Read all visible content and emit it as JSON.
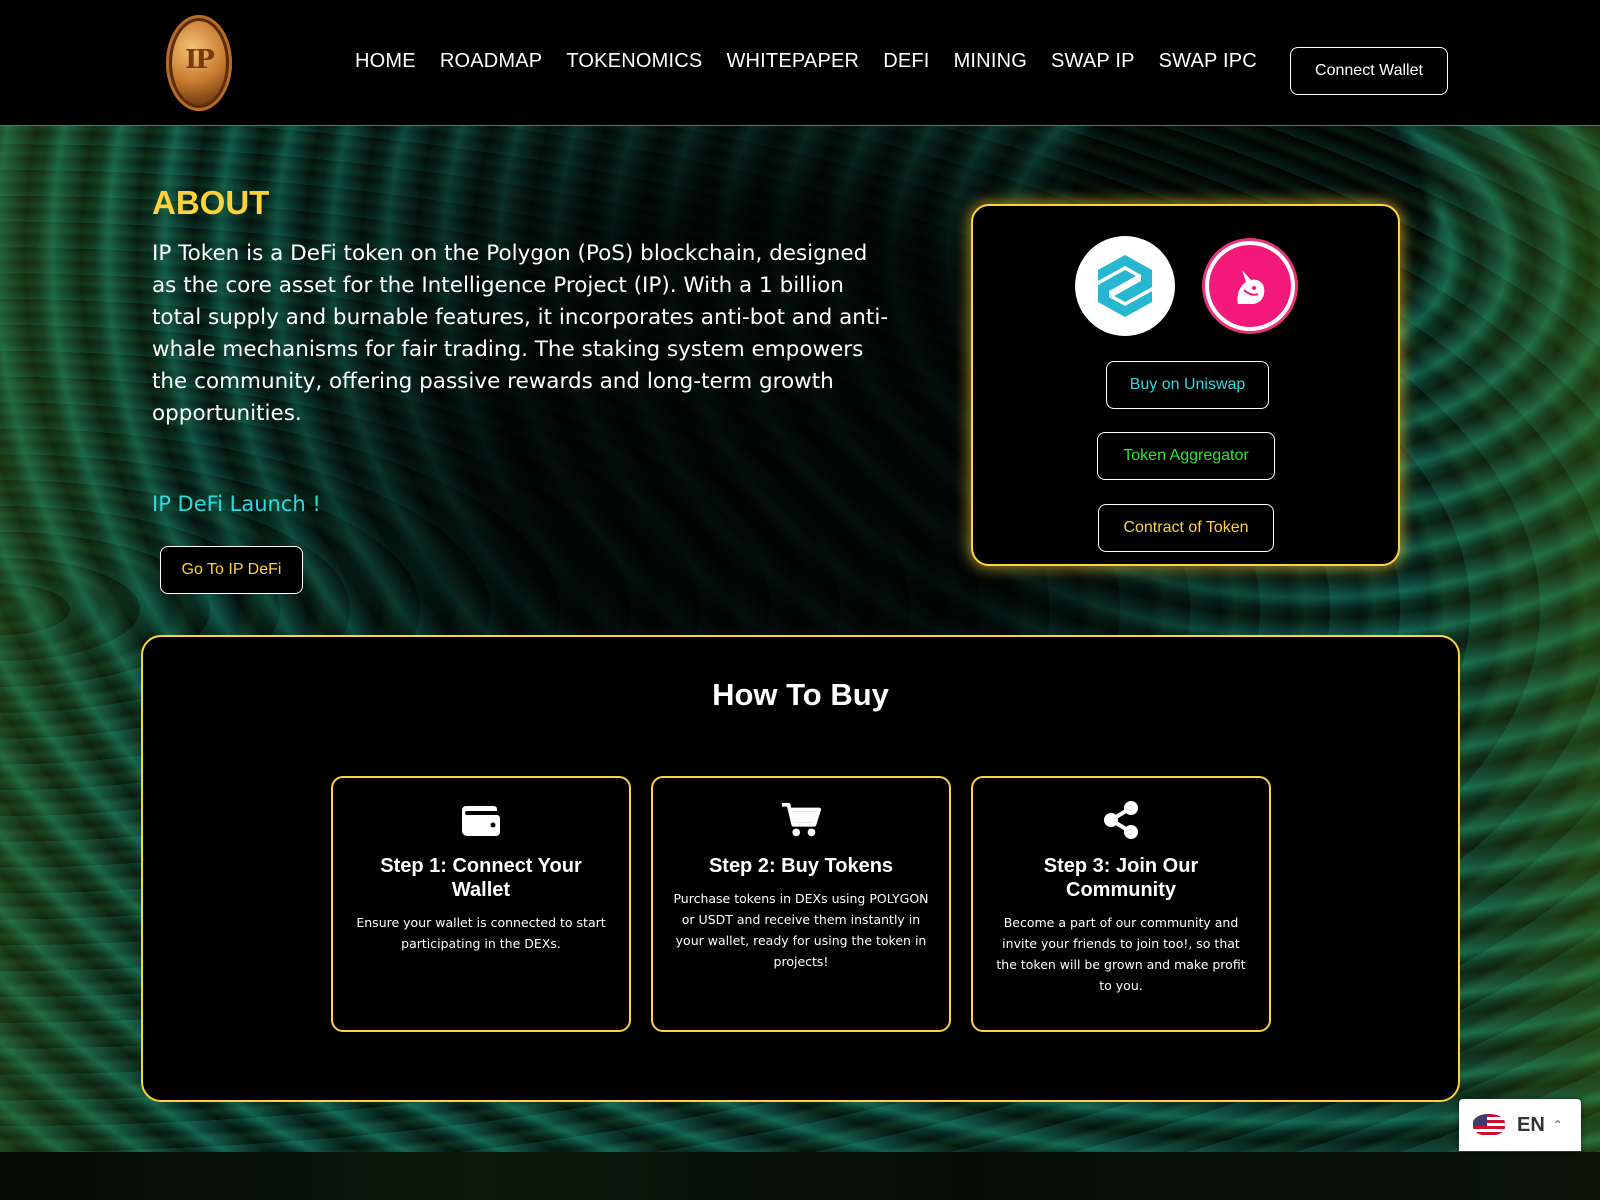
{
  "header": {
    "nav": [
      "HOME",
      "ROADMAP",
      "TOKENOMICS",
      "WHITEPAPER",
      "DEFI",
      "MINING",
      "SWAP IP",
      "SWAP IPC"
    ],
    "connect_wallet": "Connect Wallet"
  },
  "about": {
    "title": "ABOUT",
    "text": "IP Token is a DeFi token on the Polygon (PoS) blockchain, designed as the core asset for the Intelligence Project (IP). With a 1 billion total supply and burnable features, it incorporates anti-bot and anti-whale mechanisms for fair trading. The staking system empowers the community, offering passive rewards and long-term growth opportunities.",
    "launch": "IP DeFi Launch !",
    "go_defi": "Go To IP DeFi"
  },
  "buy_card": {
    "logos": [
      "dextools-icon",
      "uniswap-icon"
    ],
    "buy_uniswap": "Buy on Uniswap",
    "token_aggregator": "Token Aggregator",
    "contract": "Contract of Token"
  },
  "how_to_buy": {
    "title": "How To Buy",
    "steps": [
      {
        "icon": "wallet-icon",
        "title": "Step 1: Connect Your Wallet",
        "desc": "Ensure your wallet is connected to start participating in the DEXs."
      },
      {
        "icon": "cart-icon",
        "title": "Step 2: Buy Tokens",
        "desc": "Purchase tokens in DEXs using POLYGON or USDT and receive them instantly in your wallet, ready for using the token in projects!"
      },
      {
        "icon": "share-icon",
        "title": "Step 3: Join Our Community",
        "desc": "Become a part of our community and invite your friends to join too!, so that the token will be grown and make profit to you."
      }
    ]
  },
  "language": {
    "code": "EN",
    "flag": "us-flag-icon"
  },
  "colors": {
    "accent": "#ffd23a",
    "cyan": "#2fd9e0",
    "green": "#2ee52e",
    "background": "#000000"
  }
}
